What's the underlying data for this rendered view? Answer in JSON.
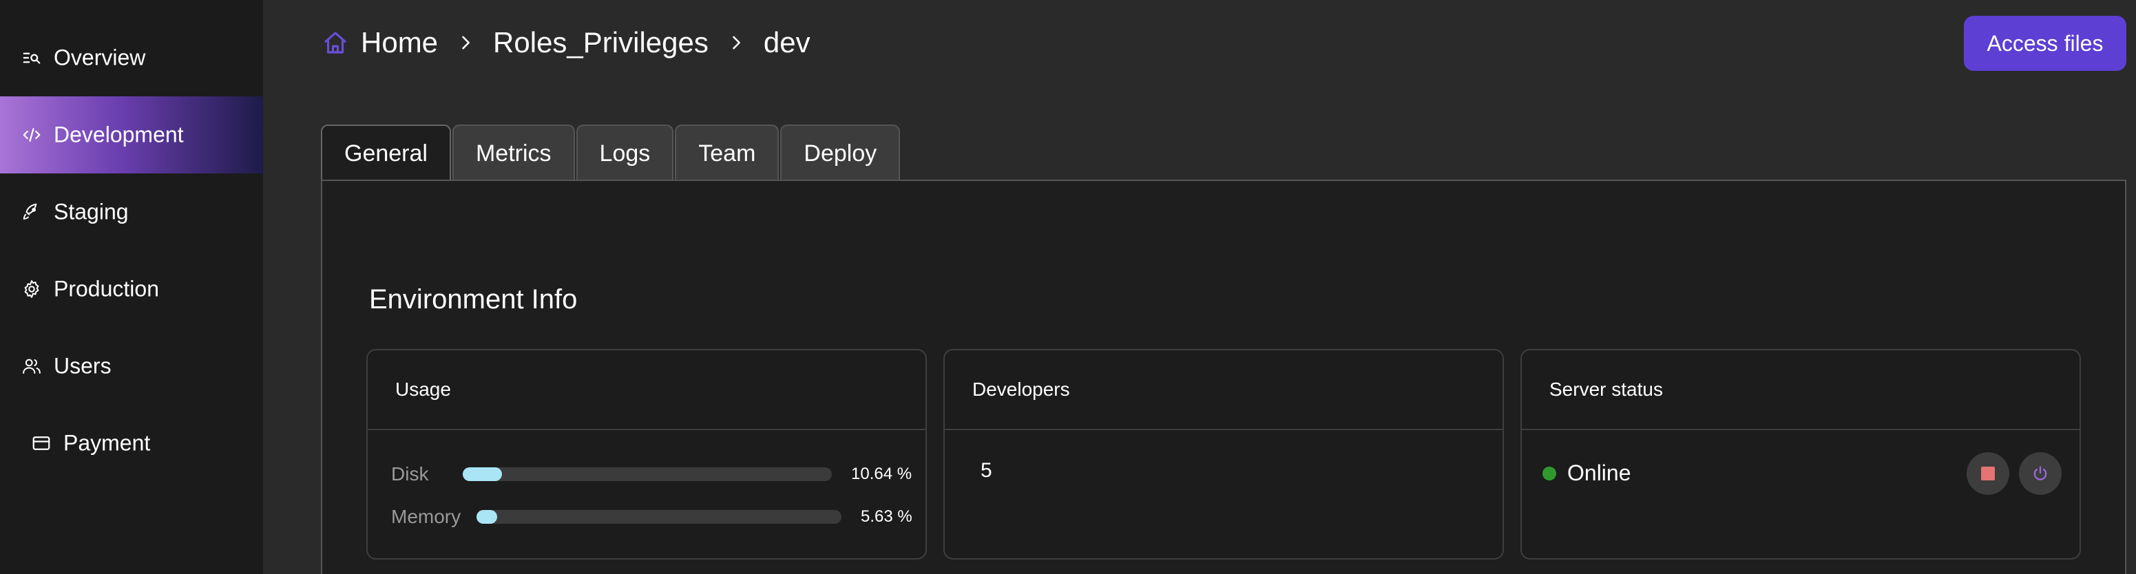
{
  "sidebar": {
    "items": [
      {
        "label": "Overview",
        "icon": "list-search-icon"
      },
      {
        "label": "Development",
        "icon": "code-icon",
        "active": true
      },
      {
        "label": "Staging",
        "icon": "rocket-icon"
      },
      {
        "label": "Production",
        "icon": "gear-icon"
      },
      {
        "label": "Users",
        "icon": "users-icon"
      },
      {
        "label": "Payment",
        "icon": "credit-card-icon"
      }
    ]
  },
  "breadcrumb": {
    "home": "Home",
    "section": "Roles_Privileges",
    "current": "dev"
  },
  "header": {
    "access_files_label": "Access files"
  },
  "tabs": [
    {
      "label": "General",
      "active": true
    },
    {
      "label": "Metrics"
    },
    {
      "label": "Logs"
    },
    {
      "label": "Team"
    },
    {
      "label": "Deploy"
    }
  ],
  "section_title": "Environment Info",
  "cards": {
    "usage": {
      "title": "Usage",
      "disk": {
        "label": "Disk",
        "value_text": "10.64 %",
        "percent": 10.64
      },
      "memory": {
        "label": "Memory",
        "value_text": "5.63 %",
        "percent": 5.63
      }
    },
    "developers": {
      "title": "Developers",
      "count": "5"
    },
    "server_status": {
      "title": "Server status",
      "status": "Online"
    }
  },
  "colors": {
    "accent": "#5d3fd3",
    "bar_fill": "#a9e5f5",
    "online": "#2e9a2e",
    "stop": "#e57373",
    "restart": "#9c6ad8"
  }
}
